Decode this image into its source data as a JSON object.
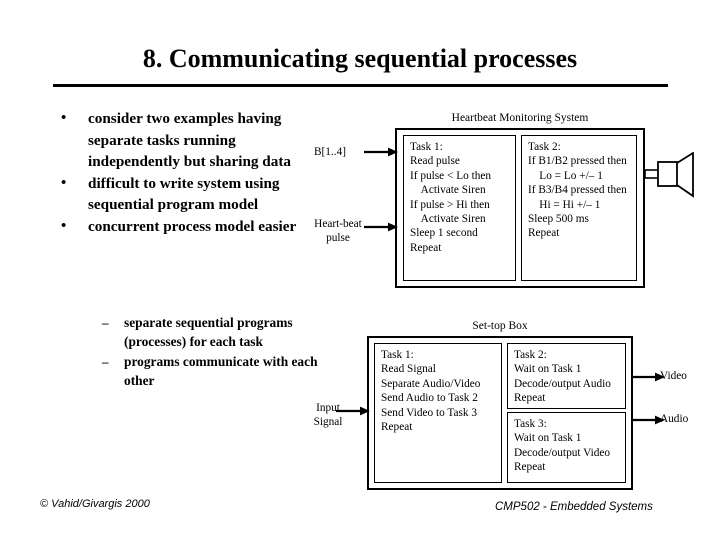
{
  "slide": {
    "title": "8. Communicating sequential processes",
    "footer_left": "© Vahid/Givargis 2000",
    "footer_right": "CMP502 - Embedded Systems"
  },
  "bullets": {
    "level1": [
      {
        "marker": "•",
        "text": "consider two examples having separate tasks running independently but sharing data"
      },
      {
        "marker": "•",
        "text": "difficult to write system using sequential program model"
      },
      {
        "marker": "•",
        "text": "concurrent process model easier"
      }
    ],
    "level2": [
      {
        "marker": "–",
        "text": "separate sequential programs (processes) for each task"
      },
      {
        "marker": "–",
        "text": "programs communicate with each other"
      }
    ]
  },
  "diagrams": [
    {
      "id": "heartbeat",
      "caption": "Heartbeat Monitoring System",
      "inputs": [
        {
          "label": "B[1..4]"
        },
        {
          "label": "Heart-beat\npulse"
        }
      ],
      "outputs": [
        {
          "label": "siren-speaker"
        }
      ],
      "tasks": [
        {
          "title": "Task 1:",
          "body": "Read pulse\nIf pulse < Lo then\n    Activate Siren\nIf pulse > Hi then\n    Activate Siren\nSleep 1 second\nRepeat"
        },
        {
          "title": "Task 2:",
          "body": "If B1/B2 pressed then\n    Lo = Lo +/– 1\nIf B3/B4 pressed then\n    Hi = Hi +/– 1\nSleep 500 ms\nRepeat"
        }
      ]
    },
    {
      "id": "settop",
      "caption": "Set-top Box",
      "inputs": [
        {
          "label": "Input\nSignal"
        }
      ],
      "outputs": [
        {
          "label": "Video"
        },
        {
          "label": "Audio"
        }
      ],
      "tasks": [
        {
          "title": "Task 1:",
          "body": "Read Signal\nSeparate Audio/Video\nSend Audio to Task 2\nSend Video to Task 3\nRepeat"
        },
        {
          "title": "Task 2:",
          "body": "Wait on Task 1\nDecode/output Audio\nRepeat"
        },
        {
          "title": "Task 3:",
          "body": "Wait on Task 1\nDecode/output Video\nRepeat"
        }
      ]
    }
  ],
  "colors": {
    "ink": "#000000",
    "paper": "#ffffff"
  }
}
